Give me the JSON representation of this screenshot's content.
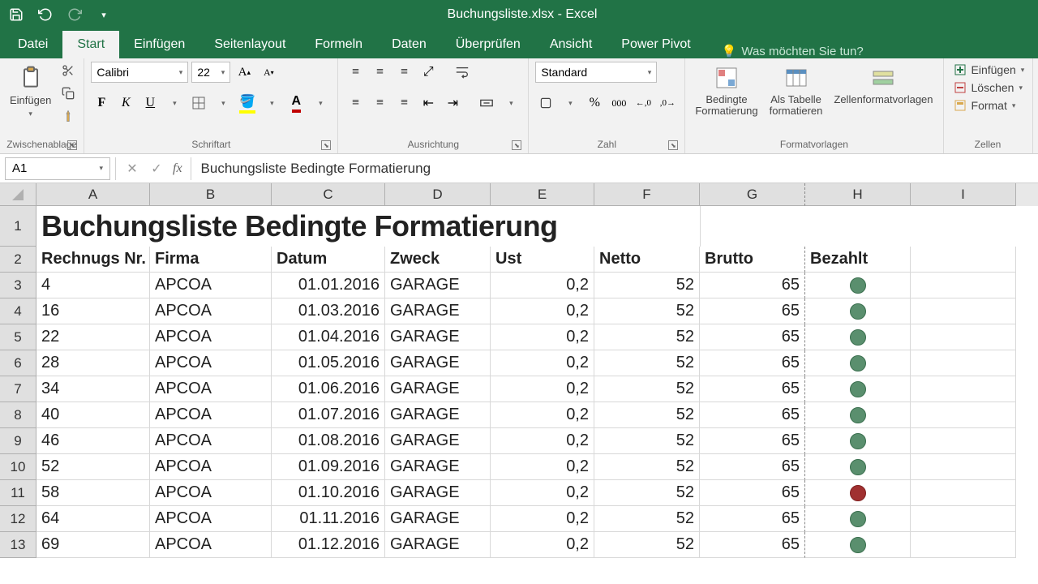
{
  "app": {
    "title": "Buchungsliste.xlsx - Excel"
  },
  "tabs": {
    "datei": "Datei",
    "start": "Start",
    "einfuegen": "Einfügen",
    "seitenlayout": "Seitenlayout",
    "formeln": "Formeln",
    "daten": "Daten",
    "ueberpruefen": "Überprüfen",
    "ansicht": "Ansicht",
    "powerpivot": "Power Pivot",
    "tellme": "Was möchten Sie tun?"
  },
  "ribbon": {
    "clipboard": {
      "paste": "Einfügen",
      "label": "Zwischenablage"
    },
    "font": {
      "name": "Calibri",
      "size": "22",
      "label": "Schriftart",
      "bold": "F",
      "italic": "K",
      "underline": "U"
    },
    "alignment": {
      "label": "Ausrichtung"
    },
    "number": {
      "format": "Standard",
      "label": "Zahl"
    },
    "styles": {
      "cond": "Bedingte Formatierung",
      "table": "Als Tabelle formatieren",
      "cell": "Zellenformatvorlagen",
      "label": "Formatvorlagen"
    },
    "cells": {
      "insert": "Einfügen",
      "delete": "Löschen",
      "format": "Format",
      "label": "Zellen"
    }
  },
  "namebox": "A1",
  "formula": "Buchungsliste Bedingte Formatierung",
  "columns": [
    "A",
    "B",
    "C",
    "D",
    "E",
    "F",
    "G",
    "H",
    "I"
  ],
  "row_nums": [
    "1",
    "2",
    "3",
    "4",
    "5",
    "6",
    "7",
    "8",
    "9",
    "10",
    "11",
    "12",
    "13"
  ],
  "sheet": {
    "title": "Buchungsliste Bedingte Formatierung",
    "headers": {
      "a": "Rechnugs Nr.",
      "b": "Firma",
      "c": "Datum",
      "d": "Zweck",
      "e": "Ust",
      "f": "Netto",
      "g": "Brutto",
      "h": "Bezahlt"
    },
    "rows": [
      {
        "nr": "4",
        "firma": "APCOA",
        "datum": "01.01.2016",
        "zweck": "GARAGE",
        "ust": "0,2",
        "netto": "52",
        "brutto": "65",
        "status": "green"
      },
      {
        "nr": "16",
        "firma": "APCOA",
        "datum": "01.03.2016",
        "zweck": "GARAGE",
        "ust": "0,2",
        "netto": "52",
        "brutto": "65",
        "status": "green"
      },
      {
        "nr": "22",
        "firma": "APCOA",
        "datum": "01.04.2016",
        "zweck": "GARAGE",
        "ust": "0,2",
        "netto": "52",
        "brutto": "65",
        "status": "green"
      },
      {
        "nr": "28",
        "firma": "APCOA",
        "datum": "01.05.2016",
        "zweck": "GARAGE",
        "ust": "0,2",
        "netto": "52",
        "brutto": "65",
        "status": "green"
      },
      {
        "nr": "34",
        "firma": "APCOA",
        "datum": "01.06.2016",
        "zweck": "GARAGE",
        "ust": "0,2",
        "netto": "52",
        "brutto": "65",
        "status": "green"
      },
      {
        "nr": "40",
        "firma": "APCOA",
        "datum": "01.07.2016",
        "zweck": "GARAGE",
        "ust": "0,2",
        "netto": "52",
        "brutto": "65",
        "status": "green"
      },
      {
        "nr": "46",
        "firma": "APCOA",
        "datum": "01.08.2016",
        "zweck": "GARAGE",
        "ust": "0,2",
        "netto": "52",
        "brutto": "65",
        "status": "green"
      },
      {
        "nr": "52",
        "firma": "APCOA",
        "datum": "01.09.2016",
        "zweck": "GARAGE",
        "ust": "0,2",
        "netto": "52",
        "brutto": "65",
        "status": "green"
      },
      {
        "nr": "58",
        "firma": "APCOA",
        "datum": "01.10.2016",
        "zweck": "GARAGE",
        "ust": "0,2",
        "netto": "52",
        "brutto": "65",
        "status": "red"
      },
      {
        "nr": "64",
        "firma": "APCOA",
        "datum": "01.11.2016",
        "zweck": "GARAGE",
        "ust": "0,2",
        "netto": "52",
        "brutto": "65",
        "status": "green"
      },
      {
        "nr": "69",
        "firma": "APCOA",
        "datum": "01.12.2016",
        "zweck": "GARAGE",
        "ust": "0,2",
        "netto": "52",
        "brutto": "65",
        "status": "green"
      }
    ]
  }
}
